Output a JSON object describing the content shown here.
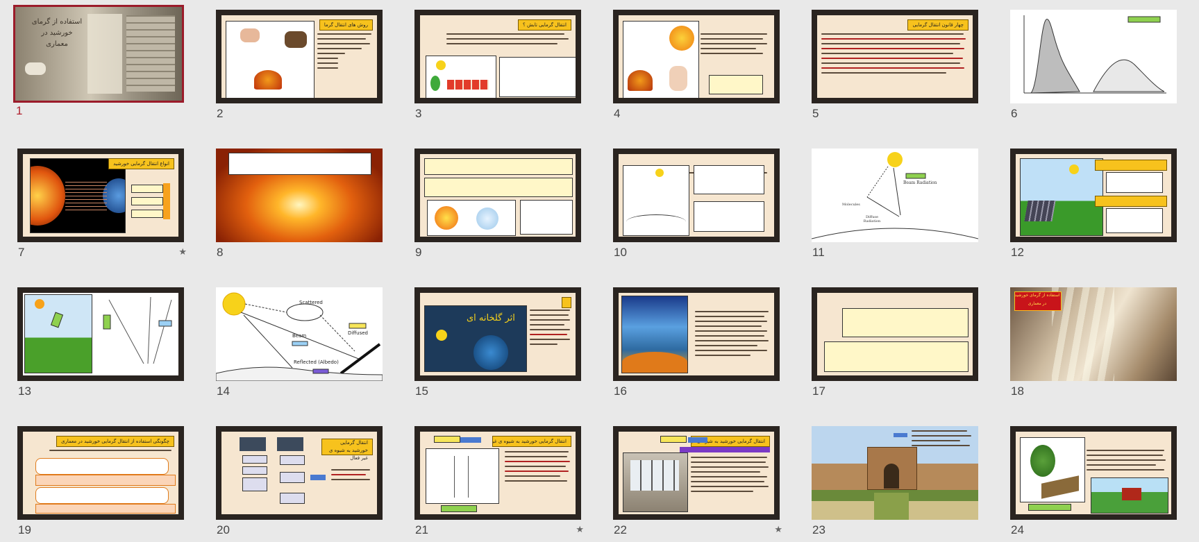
{
  "slides": [
    {
      "number": "1",
      "selected": true,
      "starred": false,
      "title": "استفاده از گرمای خورشید در معماری"
    },
    {
      "number": "2",
      "selected": false,
      "starred": false,
      "title": "روش های انتقال گرما"
    },
    {
      "number": "3",
      "selected": false,
      "starred": false,
      "title": "انتقال گرمایی تابش ؟"
    },
    {
      "number": "4",
      "selected": false,
      "starred": false,
      "title": ""
    },
    {
      "number": "5",
      "selected": false,
      "starred": false,
      "title": "چهار قانون انتقال گرمایی"
    },
    {
      "number": "6",
      "selected": false,
      "starred": false,
      "title": ""
    },
    {
      "number": "7",
      "selected": false,
      "starred": true,
      "title": "انواع انتقال گرمایی خورشید"
    },
    {
      "number": "8",
      "selected": false,
      "starred": false,
      "title": ""
    },
    {
      "number": "9",
      "selected": false,
      "starred": false,
      "title": ""
    },
    {
      "number": "10",
      "selected": false,
      "starred": false,
      "title": ""
    },
    {
      "number": "11",
      "selected": false,
      "starred": false,
      "title": "Beam Radiation"
    },
    {
      "number": "12",
      "selected": false,
      "starred": false,
      "title": ""
    },
    {
      "number": "13",
      "selected": false,
      "starred": false,
      "title": ""
    },
    {
      "number": "14",
      "selected": false,
      "starred": false,
      "title": "Scattered"
    },
    {
      "number": "15",
      "selected": false,
      "starred": false,
      "title": "اثر گلخانه ای"
    },
    {
      "number": "16",
      "selected": false,
      "starred": false,
      "title": ""
    },
    {
      "number": "17",
      "selected": false,
      "starred": false,
      "title": ""
    },
    {
      "number": "18",
      "selected": false,
      "starred": false,
      "title": "استفاده از گرمای خورشید در معماری"
    },
    {
      "number": "19",
      "selected": false,
      "starred": false,
      "title": "چگونگی استفاده از انتقال گرمایی خورشید در معماری"
    },
    {
      "number": "20",
      "selected": false,
      "starred": false,
      "title": "انتقال گرمایی خورشید به شیوه ی غیر فعال"
    },
    {
      "number": "21",
      "selected": false,
      "starred": true,
      "title": "انتقال گرمایی خورشید به شیوه ی غیر فعال"
    },
    {
      "number": "22",
      "selected": false,
      "starred": true,
      "title": "انتقال گرمایی خورشید به شیوه ی غیر فعال"
    },
    {
      "number": "23",
      "selected": false,
      "starred": false,
      "title": ""
    },
    {
      "number": "24",
      "selected": false,
      "starred": false,
      "title": ""
    }
  ],
  "slide14_labels": {
    "scattered": "Scattered",
    "beam": "Beam",
    "diffused": "Diffused",
    "reflected": "Reflected (Albedo)"
  },
  "slide11_labels": {
    "beam": "Beam Radiation",
    "molecules": "Molecules",
    "diffuse": "Diffuse Radiation"
  },
  "colors": {
    "background": "#e9e9e9",
    "selected_border": "#9b1b2a",
    "slide_bg": "#f6e6d0",
    "title_tag": "#f7c21d",
    "frame": "#2a2420"
  }
}
